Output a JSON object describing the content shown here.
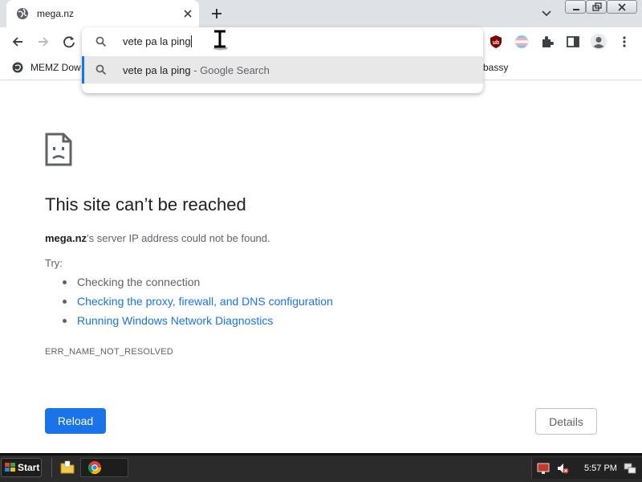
{
  "browser": {
    "tab": {
      "title": "mega.nz"
    },
    "omnibox": {
      "input_value": "vete pa la ping",
      "suggestion": {
        "query": "vete pa la ping",
        "suffix": " - Google Search"
      }
    },
    "bookmarks": [
      {
        "label": "MEMZ Dow"
      },
      {
        "label": "bassy"
      }
    ]
  },
  "error_page": {
    "heading": "This site can’t be reached",
    "description_host": "mega.nz",
    "description_rest": "’s server IP address could not be found.",
    "try_label": "Try:",
    "suggestions": [
      {
        "text": "Checking the connection",
        "link": false
      },
      {
        "text": "Checking the proxy, firewall, and DNS configuration",
        "link": true
      },
      {
        "text": "Running Windows Network Diagnostics",
        "link": true
      }
    ],
    "error_code": "ERR_NAME_NOT_RESOLVED",
    "reload_label": "Reload",
    "details_label": "Details"
  },
  "taskbar": {
    "start_label": "Start",
    "clock": "5:57 PM"
  },
  "icons": {
    "tab_favicon": "globe-icon",
    "back": "back-arrow-icon",
    "forward": "forward-arrow-icon",
    "reload": "reload-icon",
    "extensions": [
      "ublock-icon",
      "flag-icon",
      "puzzle-icon",
      "sidepanel-icon",
      "profile-icon",
      "menu-dots-icon"
    ]
  },
  "colors": {
    "accent": "#1a73e8",
    "tabstrip": "#dee1e6",
    "text": "#202124",
    "muted": "#5f6368",
    "taskbar": "#2b2b2b"
  }
}
